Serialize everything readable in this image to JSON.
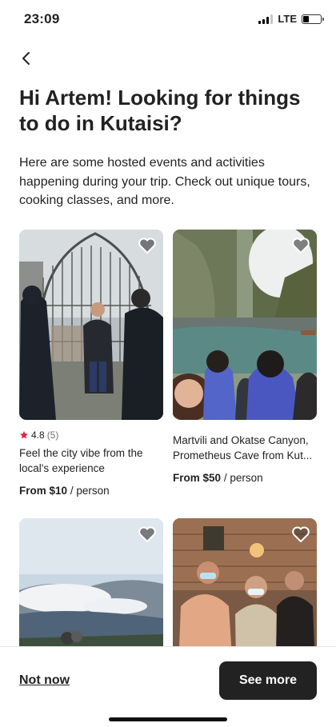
{
  "status_bar": {
    "time": "23:09",
    "network": "LTE",
    "battery_level": 0.35,
    "icons": [
      "signal-icon",
      "battery-icon"
    ]
  },
  "header": {
    "back_icon": "chevron-left-icon"
  },
  "title": "Hi Artem! Looking for things to do in Kutaisi?",
  "intro": "Here are some hosted events and activities happening during your trip. Check out unique tours, cooking classes, and more.",
  "cards": [
    {
      "rating": "4.8",
      "reviews": "(5)",
      "title": "Feel the city vibe from the local's experience",
      "price_prefix": "From",
      "price": "$10",
      "price_suffix": "/ person",
      "favorite": true,
      "icon": "heart-icon"
    },
    {
      "title": "Martvili and Okatse Canyon, Prometheus Cave from Kut...",
      "price_prefix": "From",
      "price": "$50",
      "price_suffix": "/ person",
      "favorite": false,
      "icon": "heart-icon"
    },
    {
      "favorite": false,
      "icon": "heart-icon"
    },
    {
      "favorite": false,
      "icon": "heart-icon"
    }
  ],
  "footer": {
    "not_now": "Not now",
    "see_more": "See more"
  },
  "colors": {
    "text": "#222222",
    "muted": "#717171",
    "star": "#e0204a",
    "button_bg": "#222222",
    "button_text": "#ffffff"
  }
}
